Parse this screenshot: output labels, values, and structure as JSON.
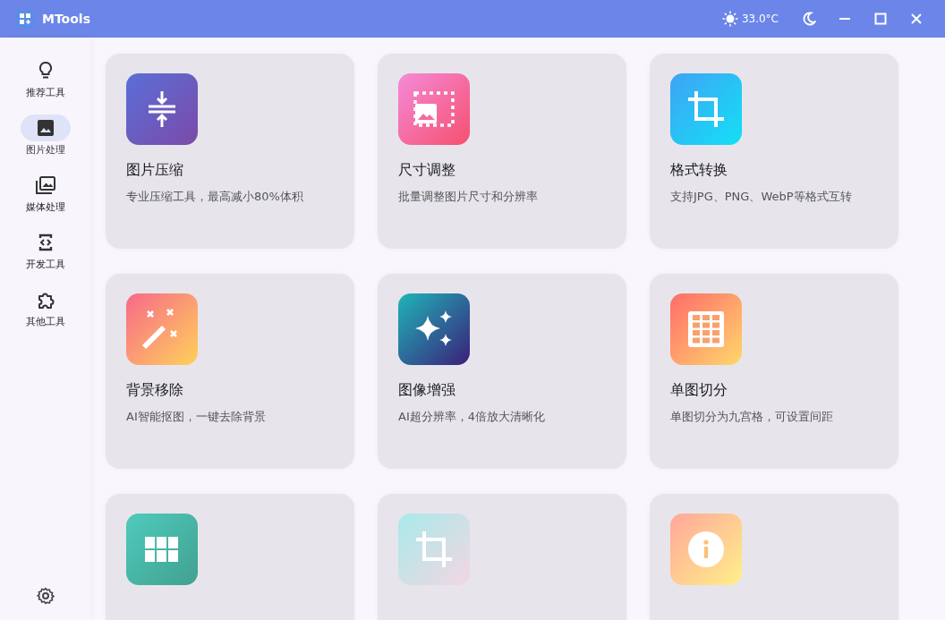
{
  "window": {
    "title": "MTools"
  },
  "title_bar": {
    "temperature": "33.0°C"
  },
  "sidebar": {
    "items": [
      {
        "label": "推荐工具",
        "selected": false
      },
      {
        "label": "图片处理",
        "selected": true
      },
      {
        "label": "媒体处理",
        "selected": false
      },
      {
        "label": "开发工具",
        "selected": false
      },
      {
        "label": "其他工具",
        "selected": false
      }
    ]
  },
  "tools": [
    {
      "kind": "compress",
      "title": "图片压缩",
      "description": "专业压缩工具，最高减小80%体积"
    },
    {
      "kind": "resize",
      "title": "尺寸调整",
      "description": "批量调整图片尺寸和分辨率"
    },
    {
      "kind": "convert",
      "title": "格式转换",
      "description": "支持JPG、PNG、WebP等格式互转"
    },
    {
      "kind": "remove",
      "title": "背景移除",
      "description": "AI智能抠图，一键去除背景"
    },
    {
      "kind": "enhance",
      "title": "图像增强",
      "description": "AI超分辨率，4倍放大清晰化"
    },
    {
      "kind": "split",
      "title": "单图切分",
      "description": "单图切分为九宫格，可设置间距"
    },
    {
      "kind": "merge"
    },
    {
      "kind": "crop"
    },
    {
      "kind": "info"
    }
  ]
}
